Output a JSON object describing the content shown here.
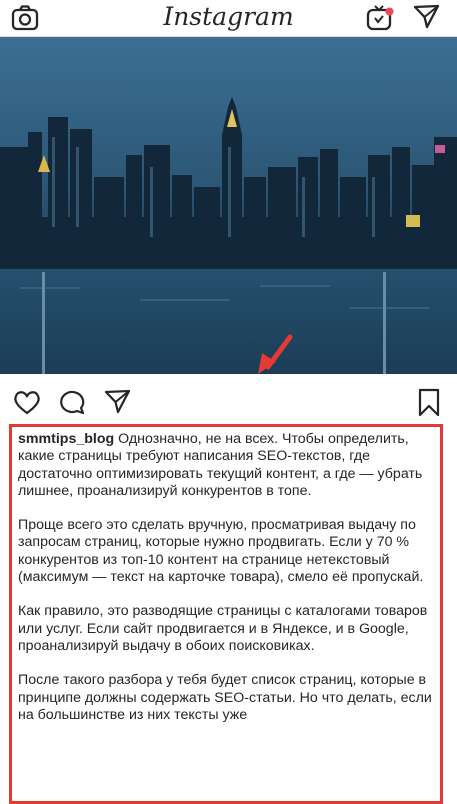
{
  "header": {
    "title": "Instagram",
    "icons": [
      "camera-icon",
      "igtv-icon",
      "direct-message-icon"
    ],
    "notification_dot_color": "#ed4956"
  },
  "post": {
    "image": "city-skyline-at-dusk-photo",
    "actions": [
      "heart-icon",
      "comment-icon",
      "share-icon",
      "bookmark-icon"
    ],
    "caption": {
      "username": "smmtips_blog",
      "paragraph_1": "Однозначно, не на всех. Чтобы определить, какие страницы требуют написания SEO-текстов, где достаточно оптимизировать текущий контент, а где — убрать лишнее, проанализируй конкурентов в топе.",
      "paragraph_2": "Проще всего это сделать вручную, просматривая выдачу по запросам страниц, которые нужно продвигать. Если у 70 % конкурентов из топ-10 контент на странице нетекстовый (максимум — текст на карточке товара), смело её пропускай.",
      "paragraph_3": "Как правило, это разводящие страницы с каталогами товаров или услуг. Если сайт продвигается и в Яндексе, и в Google, проанализируй выдачу в обоих поисковиках.",
      "paragraph_4": "После такого разбора у тебя будет список страниц, которые в принципе должны содержать SEO-статьи. Но что делать, если на большинстве из них тексты уже"
    }
  },
  "annotation": {
    "color": "#e53935"
  }
}
